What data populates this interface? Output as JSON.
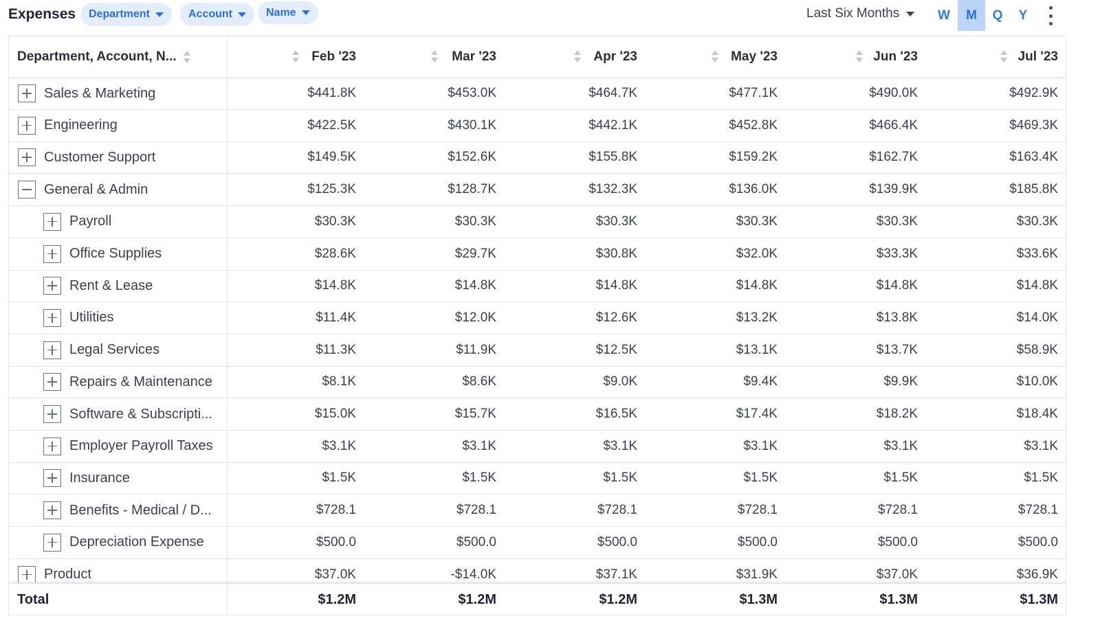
{
  "toolbar": {
    "title": "Expenses",
    "chips": [
      "Department",
      "Account",
      "Name"
    ],
    "range": "Last Six Months",
    "granularity": [
      "W",
      "M",
      "Q",
      "Y"
    ],
    "granularity_selected": "M",
    "more_icon": "kebab-icon"
  },
  "table": {
    "first_header": "Department, Account, N...",
    "months": [
      "Feb '23",
      "Mar '23",
      "Apr '23",
      "May '23",
      "Jun '23",
      "Jul '23"
    ],
    "rows": [
      {
        "label": "Sales & Marketing",
        "level": 0,
        "expanded": false,
        "values": [
          "$441.8K",
          "$453.0K",
          "$464.7K",
          "$477.1K",
          "$490.0K",
          "$492.9K"
        ]
      },
      {
        "label": "Engineering",
        "level": 0,
        "expanded": false,
        "values": [
          "$422.5K",
          "$430.1K",
          "$442.1K",
          "$452.8K",
          "$466.4K",
          "$469.3K"
        ]
      },
      {
        "label": "Customer Support",
        "level": 0,
        "expanded": false,
        "values": [
          "$149.5K",
          "$152.6K",
          "$155.8K",
          "$159.2K",
          "$162.7K",
          "$163.4K"
        ]
      },
      {
        "label": "General & Admin",
        "level": 0,
        "expanded": true,
        "values": [
          "$125.3K",
          "$128.7K",
          "$132.3K",
          "$136.0K",
          "$139.9K",
          "$185.8K"
        ]
      },
      {
        "label": "Payroll",
        "level": 1,
        "expanded": false,
        "values": [
          "$30.3K",
          "$30.3K",
          "$30.3K",
          "$30.3K",
          "$30.3K",
          "$30.3K"
        ]
      },
      {
        "label": "Office Supplies",
        "level": 1,
        "expanded": false,
        "values": [
          "$28.6K",
          "$29.7K",
          "$30.8K",
          "$32.0K",
          "$33.3K",
          "$33.6K"
        ]
      },
      {
        "label": "Rent & Lease",
        "level": 1,
        "expanded": false,
        "values": [
          "$14.8K",
          "$14.8K",
          "$14.8K",
          "$14.8K",
          "$14.8K",
          "$14.8K"
        ]
      },
      {
        "label": "Utilities",
        "level": 1,
        "expanded": false,
        "values": [
          "$11.4K",
          "$12.0K",
          "$12.6K",
          "$13.2K",
          "$13.8K",
          "$14.0K"
        ]
      },
      {
        "label": "Legal Services",
        "level": 1,
        "expanded": false,
        "values": [
          "$11.3K",
          "$11.9K",
          "$12.5K",
          "$13.1K",
          "$13.7K",
          "$58.9K"
        ]
      },
      {
        "label": "Repairs & Maintenance",
        "level": 1,
        "expanded": false,
        "values": [
          "$8.1K",
          "$8.6K",
          "$9.0K",
          "$9.4K",
          "$9.9K",
          "$10.0K"
        ]
      },
      {
        "label": "Software & Subscripti...",
        "level": 1,
        "expanded": false,
        "values": [
          "$15.0K",
          "$15.7K",
          "$16.5K",
          "$17.4K",
          "$18.2K",
          "$18.4K"
        ]
      },
      {
        "label": "Employer Payroll Taxes",
        "level": 1,
        "expanded": false,
        "values": [
          "$3.1K",
          "$3.1K",
          "$3.1K",
          "$3.1K",
          "$3.1K",
          "$3.1K"
        ]
      },
      {
        "label": "Insurance",
        "level": 1,
        "expanded": false,
        "values": [
          "$1.5K",
          "$1.5K",
          "$1.5K",
          "$1.5K",
          "$1.5K",
          "$1.5K"
        ]
      },
      {
        "label": "Benefits - Medical / D...",
        "level": 1,
        "expanded": false,
        "values": [
          "$728.1",
          "$728.1",
          "$728.1",
          "$728.1",
          "$728.1",
          "$728.1"
        ]
      },
      {
        "label": "Depreciation Expense",
        "level": 1,
        "expanded": false,
        "values": [
          "$500.0",
          "$500.0",
          "$500.0",
          "$500.0",
          "$500.0",
          "$500.0"
        ]
      },
      {
        "label": "Product",
        "level": 0,
        "expanded": false,
        "values": [
          "$37.0K",
          "-$14.0K",
          "$37.1K",
          "$31.9K",
          "$37.0K",
          "$36.9K"
        ]
      }
    ],
    "total": {
      "label": "Total",
      "values": [
        "$1.2M",
        "$1.2M",
        "$1.2M",
        "$1.3M",
        "$1.3M",
        "$1.3M"
      ]
    }
  },
  "colors": {
    "accent": "#2f6fd1",
    "chip_bg": "#e3edfb",
    "active_bg": "#bcd4f5",
    "border": "#e3e5e9"
  }
}
